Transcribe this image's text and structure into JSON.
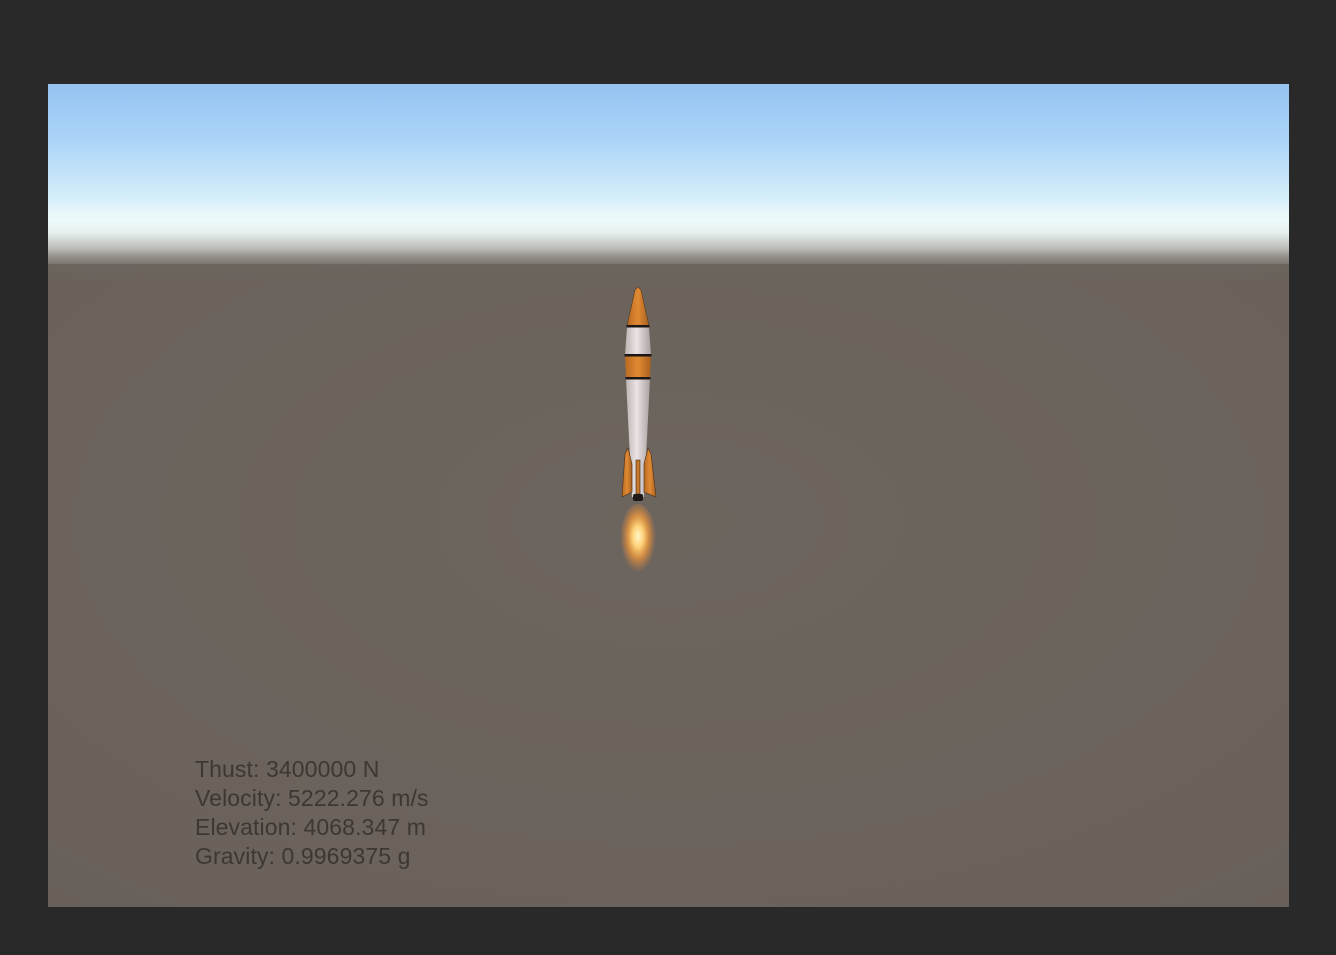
{
  "hud": {
    "thrust": "Thust: 3400000 N",
    "velocity": "Velocity: 5222.276 m/s",
    "elevation": "Elevation: 4068.347 m",
    "gravity": "Gravity: 0.9969375 g"
  },
  "colors": {
    "background": "#292929",
    "ground": "#696159",
    "sky_top": "#95c2f2",
    "horizon": "#eefbfb",
    "rocket_orange": "#d9852f",
    "rocket_body": "#e6dcdc",
    "flame": "#ffb347",
    "hud_text": "#3c3733"
  },
  "scene": {
    "objects": [
      "rocket",
      "engine-flame",
      "sky",
      "ground-plane"
    ]
  }
}
